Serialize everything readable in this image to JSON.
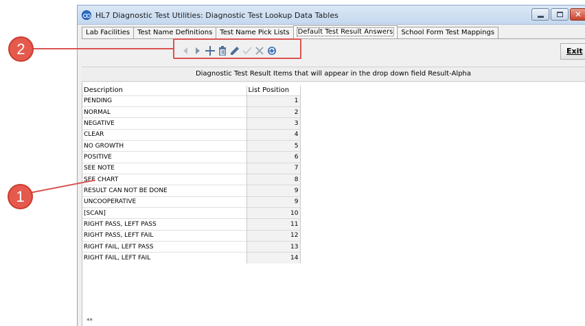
{
  "window": {
    "title": "HL7 Diagnostic Test Utilities:  Diagnostic Test Lookup Data Tables"
  },
  "tabs": [
    {
      "label": "Lab Facilities",
      "active": false
    },
    {
      "label": "Test Name Definitions",
      "active": false
    },
    {
      "label": "Test Name Pick Lists",
      "active": false
    },
    {
      "label": "Default Test Result Answers",
      "active": true
    },
    {
      "label": "School Form Test Mappings",
      "active": false
    }
  ],
  "toolbar": {
    "buttons": [
      "prior-icon",
      "next-icon",
      "insert-icon",
      "delete-icon",
      "edit-icon",
      "post-icon",
      "cancel-icon",
      "refresh-icon"
    ],
    "exit_label": "Exit"
  },
  "grid": {
    "header_text": "Diagnostic Test Result Items that will appear in the drop down field Result-Alpha",
    "columns": [
      "Description",
      "List Position"
    ],
    "rows": [
      {
        "description": "PENDING",
        "position": "1"
      },
      {
        "description": "NORMAL",
        "position": "2"
      },
      {
        "description": "NEGATIVE",
        "position": "3"
      },
      {
        "description": "CLEAR",
        "position": "4"
      },
      {
        "description": "NO GROWTH",
        "position": "5"
      },
      {
        "description": "POSITIVE",
        "position": "6"
      },
      {
        "description": "SEE NOTE",
        "position": "7"
      },
      {
        "description": "SEE CHART",
        "position": "8"
      },
      {
        "description": "RESULT CAN NOT BE DONE",
        "position": "9"
      },
      {
        "description": "UNCOOPERATIVE",
        "position": "9"
      },
      {
        "description": "[SCAN]",
        "position": "10"
      },
      {
        "description": "RIGHT PASS,  LEFT PASS",
        "position": "11"
      },
      {
        "description": "RIGHT PASS, LEFT FAIL",
        "position": "12"
      },
      {
        "description": "RIGHT FAIL, LEFT PASS",
        "position": "13"
      },
      {
        "description": "RIGHT FAIL, LEFT FAIL",
        "position": "14"
      }
    ],
    "footer_mark": "**"
  },
  "callouts": {
    "badge_1": "1",
    "badge_2": "2",
    "color": "#d9534f"
  }
}
